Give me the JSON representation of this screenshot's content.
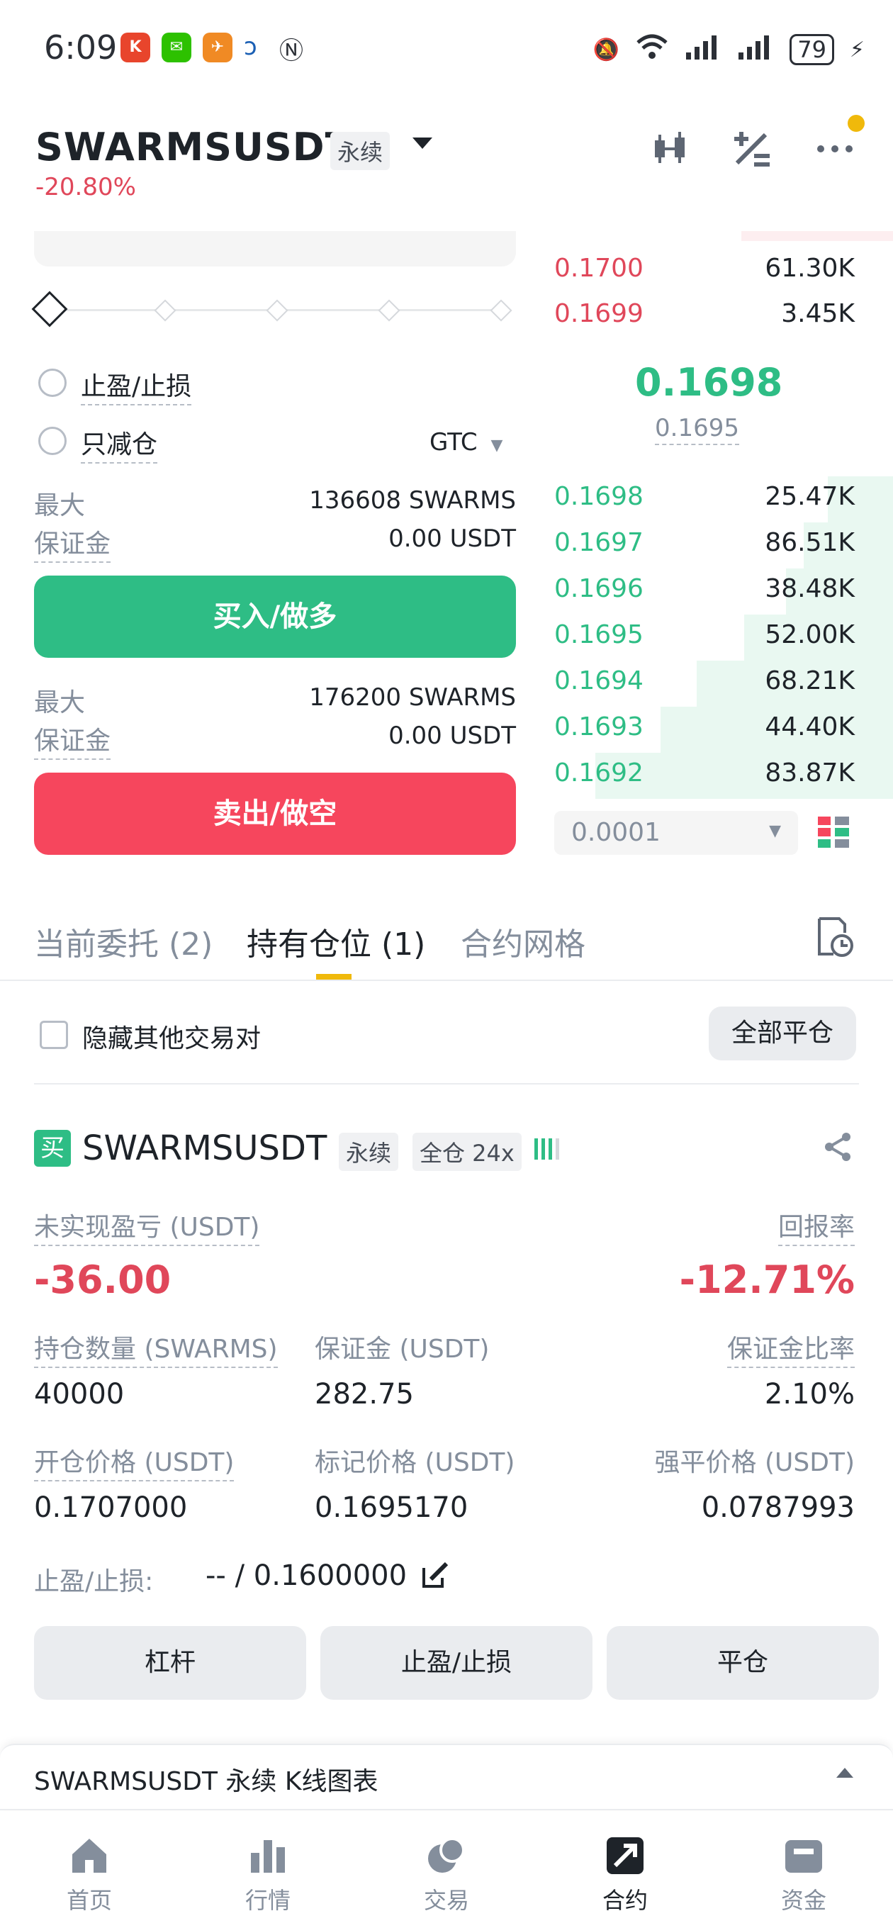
{
  "status_bar": {
    "time": "6:09",
    "battery": "79"
  },
  "header": {
    "pair": "SWARMSUSDT",
    "badge": "永续",
    "change": "-20.80%"
  },
  "order_form": {
    "tp_sl_label": "止盈/止损",
    "reduce_only_label": "只减仓",
    "tif_value": "GTC",
    "buy_max_label": "最大",
    "buy_max_value": "136608 SWARMS",
    "buy_margin_label": "保证金",
    "buy_margin_value": "0.00 USDT",
    "buy_button": "买入/做多",
    "sell_max_label": "最大",
    "sell_max_value": "176200 SWARMS",
    "sell_margin_label": "保证金",
    "sell_margin_value": "0.00 USDT",
    "sell_button": "卖出/做空"
  },
  "order_book": {
    "asks": [
      {
        "price": "0.1700",
        "qty": "61.30K"
      },
      {
        "price": "0.1699",
        "qty": "3.45K"
      }
    ],
    "last_price": "0.1698",
    "mark_price": "0.1695",
    "bids": [
      {
        "price": "0.1698",
        "qty": "25.47K",
        "depth": 0.22
      },
      {
        "price": "0.1697",
        "qty": "86.51K",
        "depth": 0.3
      },
      {
        "price": "0.1696",
        "qty": "38.48K",
        "depth": 0.36
      },
      {
        "price": "0.1695",
        "qty": "52.00K",
        "depth": 0.5
      },
      {
        "price": "0.1694",
        "qty": "68.21K",
        "depth": 0.66
      },
      {
        "price": "0.1693",
        "qty": "44.40K",
        "depth": 0.78
      },
      {
        "price": "0.1692",
        "qty": "83.87K",
        "depth": 1.0
      }
    ],
    "precision": "0.0001"
  },
  "tabs": [
    "当前委托 (2)",
    "持有仓位 (1)",
    "合约网格"
  ],
  "filter": {
    "hide_label": "隐藏其他交易对",
    "close_all": "全部平仓"
  },
  "position": {
    "side_badge": "买",
    "symbol": "SWARMSUSDT",
    "type": "永续",
    "margin_mode": "全仓 24x",
    "pnl_label": "未实现盈亏 (USDT)",
    "pnl_value": "-36.00",
    "roe_label": "回报率",
    "roe_value": "-12.71%",
    "size_label": "持仓数量 (SWARMS)",
    "size_value": "40000",
    "margin_label": "保证金 (USDT)",
    "margin_value": "282.75",
    "margin_ratio_label": "保证金比率",
    "margin_ratio_value": "2.10%",
    "entry_label": "开仓价格 (USDT)",
    "entry_value": "0.1707000",
    "mark_label": "标记价格 (USDT)",
    "mark_value": "0.1695170",
    "liq_label": "强平价格 (USDT)",
    "liq_value": "0.0787993",
    "tpsl_label": "止盈/止损:",
    "tpsl_value": "-- / 0.1600000",
    "btn_leverage": "杠杆",
    "btn_tpsl": "止盈/止损",
    "btn_close": "平仓"
  },
  "kline_bar": {
    "label": "SWARMSUSDT 永续 K线图表"
  },
  "bottom_nav": [
    "首页",
    "行情",
    "交易",
    "合约",
    "资金"
  ]
}
